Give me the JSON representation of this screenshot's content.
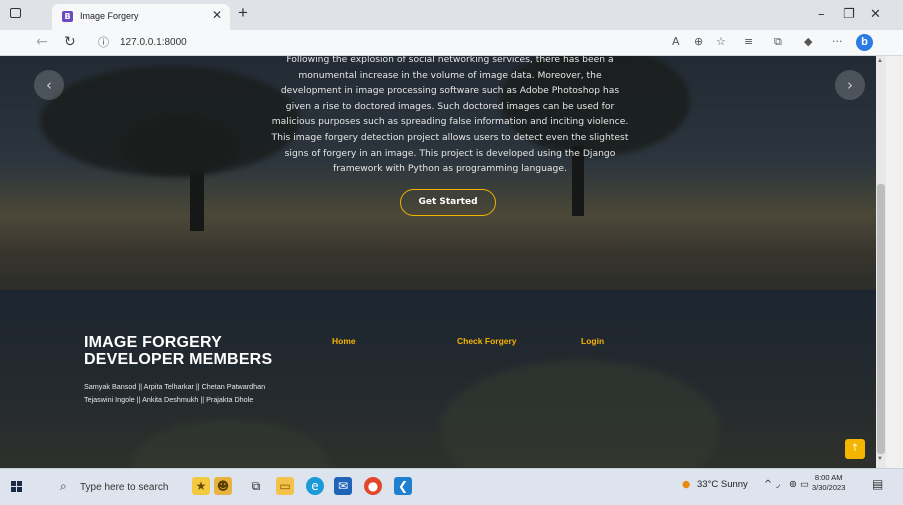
{
  "browser": {
    "tab_title": "Image Forgery",
    "tab_favicon": "B",
    "url": "127.0.0.1:8000",
    "new_tab": "+",
    "minimize": "–",
    "restore": "❐",
    "close": "✕",
    "tab_close": "✕"
  },
  "hero": {
    "description": "Following the explosion of social networking services, there has been a monumental increase in the volume of image data. Moreover, the development in image processing software such as Adobe Photoshop has given a rise to doctored images. Such doctored images can be used for malicious purposes such as spreading false information and inciting violence. This image forgery detection project allows users to detect even the slightest signs of forgery in an image. This project is developed using the Django framework with Python as programming language.",
    "cta_label": "Get Started",
    "prev_icon": "‹",
    "next_icon": "›"
  },
  "footer": {
    "title": "IMAGE FORGERY DEVELOPER MEMBERS",
    "members_line1": "Samyak Bansod || Arpita Telharkar || Chetan Patwardhan",
    "members_line2": "Tejaswini Ingole || Ankita Deshmukh || Prajakta Dhole",
    "links": [
      "Home",
      "Check Forgery",
      "Login"
    ],
    "back_to_top": "↑"
  },
  "taskbar": {
    "search_placeholder": "Type here to search",
    "weather": "33°C  Sunny",
    "time": "8:00 AM",
    "date": "3/30/2023"
  },
  "colors": {
    "accent": "#f5b400",
    "footer_bg": "#1d2530"
  }
}
